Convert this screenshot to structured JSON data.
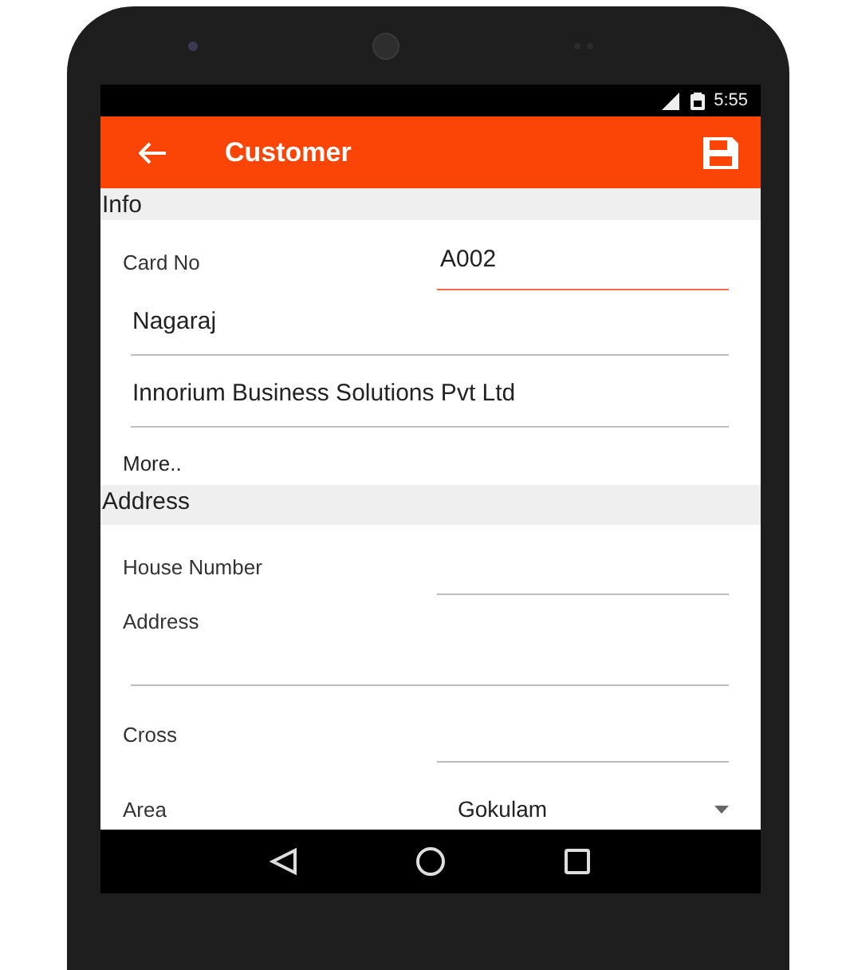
{
  "status_bar": {
    "time": "5:55"
  },
  "app_bar": {
    "title": "Customer"
  },
  "sections": [
    {
      "title": "Info",
      "fields": [
        {
          "kind": "labeled_input",
          "label": "Card No",
          "value": "A002",
          "focused": true
        },
        {
          "kind": "input",
          "value": "Nagaraj",
          "focused": false
        },
        {
          "kind": "input",
          "value": "Innorium Business Solutions Pvt Ltd",
          "focused": false
        },
        {
          "kind": "link",
          "label": "More.."
        }
      ]
    },
    {
      "title": "Address",
      "fields": [
        {
          "kind": "labeled_input",
          "label": "House Number",
          "focused": false
        },
        {
          "kind": "stacked_input",
          "label": "Address",
          "focused": false
        },
        {
          "kind": "labeled_input",
          "label": "Cross",
          "focused": false
        },
        {
          "kind": "spinner",
          "label": "Area",
          "value": "Gokulam"
        }
      ]
    }
  ]
}
